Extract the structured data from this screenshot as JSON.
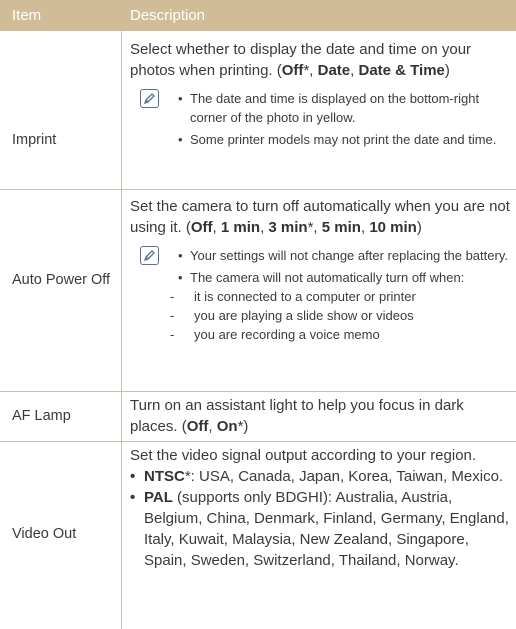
{
  "header": {
    "item": "Item",
    "description": "Description"
  },
  "rows": [
    {
      "item": "Imprint",
      "desc_text": "Select whether to display the date and time on your photos when printing. (",
      "opt1": "Off",
      "opt1_suffix": "*, ",
      "opt2": "Date",
      "opt2_suffix": ", ",
      "opt3": "Date & Time",
      "end": ")",
      "notes": [
        "The date and time is displayed on the bottom-right corner of the photo in yellow.",
        "Some printer models may not print the date and time."
      ]
    },
    {
      "item": "Auto Power Off",
      "desc_text": "Set the camera to turn off automatically when you are not using it. (",
      "opt1": "Off",
      "opt1_suffix": ", ",
      "opt2": "1 min",
      "opt2_suffix": ", ",
      "opt3": "3 min",
      "opt3_suffix": "*, ",
      "opt4": "5 min",
      "opt4_suffix": ", ",
      "opt5": "10 min",
      "end": ")",
      "notes": [
        "Your settings will not change after replacing the battery.",
        "The camera will not automatically turn off when:"
      ],
      "subnotes": [
        "it is connected to a computer or printer",
        "you are playing a slide show or videos",
        "you are recording a voice memo"
      ]
    },
    {
      "item": "AF Lamp",
      "desc_text": "Turn on an assistant light to help you focus in dark places. (",
      "opt1": "Off",
      "opt1_suffix": ", ",
      "opt2": "On",
      "opt2_suffix": "*",
      "end": ")"
    },
    {
      "item": "Video Out",
      "desc_text": "Set the video signal output according to your region.",
      "b1_label": "NTSC",
      "b1_text": "*: USA, Canada, Japan, Korea, Taiwan, Mexico.",
      "b2_label": "PAL",
      "b2_text": " (supports only BDGHI): Australia, Austria, Belgium, China, Denmark, Finland, Germany, England, Italy, Kuwait, Malaysia, New Zealand, Singapore, Spain, Sweden, Switzerland, Thailand, Norway."
    }
  ],
  "icons": {
    "note": "note-pencil-icon"
  }
}
